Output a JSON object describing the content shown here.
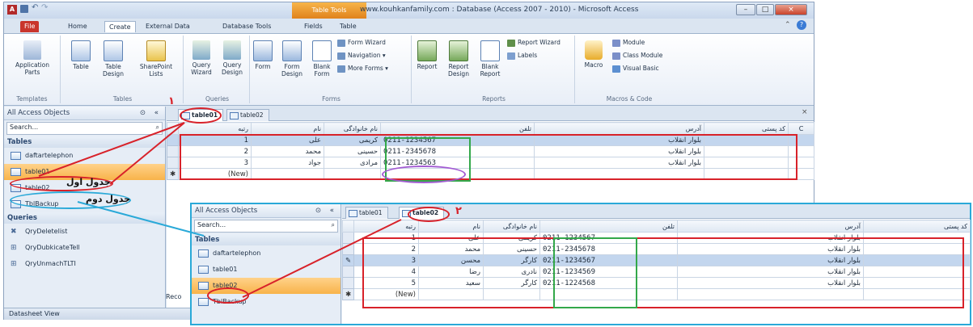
{
  "window": {
    "title": "www.kouhkanfamily.com : Database (Access 2007 - 2010) - Microsoft Access",
    "context_tab": "Table Tools",
    "controls": [
      "–",
      "□",
      "×"
    ]
  },
  "ribbon_tabs": [
    "File",
    "Home",
    "Create",
    "External Data",
    "Database Tools",
    "Fields",
    "Table"
  ],
  "ribbon": {
    "templates": {
      "label": "Templates",
      "buttons": [
        "Application Parts"
      ]
    },
    "tables": {
      "label": "Tables",
      "buttons": [
        "Table",
        "Table Design",
        "SharePoint Lists"
      ]
    },
    "queries": {
      "label": "Queries",
      "buttons": [
        "Query Wizard",
        "Query Design"
      ]
    },
    "forms": {
      "label": "Forms",
      "buttons": [
        "Form",
        "Form Design",
        "Blank Form"
      ],
      "small": [
        "Form Wizard",
        "Navigation",
        "More Forms"
      ]
    },
    "reports": {
      "label": "Reports",
      "buttons": [
        "Report",
        "Report Design",
        "Blank Report"
      ],
      "small": [
        "Report Wizard",
        "Labels"
      ]
    },
    "macros": {
      "label": "Macros & Code",
      "buttons": [
        "Macro"
      ],
      "small": [
        "Module",
        "Class Module",
        "Visual Basic"
      ]
    }
  },
  "nav": {
    "title": "All Access Objects",
    "search_placeholder": "Search...",
    "tables_header": "Tables",
    "tables": [
      "daftartelephon",
      "table01",
      "table02",
      "TblBackup"
    ],
    "queries_header": "Queries",
    "queries": [
      "QryDeletelist",
      "QryDubkicateTell",
      "QryUnmachTLTI"
    ]
  },
  "status": {
    "text": "Datasheet View"
  },
  "doc1": {
    "tabs": [
      "table01",
      "table02"
    ],
    "columns": [
      "رتبه",
      "نام",
      "نام خانوادگی",
      "تلفن",
      "آدرس",
      "کد پستی"
    ],
    "rows": [
      {
        "id": "1",
        "name": "علی",
        "family": "کریمی",
        "phone": "0211-1234567",
        "address": "بلوار انقلاب"
      },
      {
        "id": "2",
        "name": "محمد",
        "family": "حسینی",
        "phone": "0211-2345678",
        "address": "بلوار انقلاب"
      },
      {
        "id": "3",
        "name": "جواد",
        "family": "مرادی",
        "phone": "0211-1234563",
        "address": "بلوار انقلاب"
      }
    ],
    "new_label": "(New)"
  },
  "doc2": {
    "tabs": [
      "table01",
      "table02"
    ],
    "columns": [
      "رتبه",
      "نام",
      "نام خانوادگی",
      "تلفن",
      "آدرس",
      "کد پستی"
    ],
    "rows": [
      {
        "id": "1",
        "name": "علی",
        "family": "کریمی",
        "phone": "0211-1234567",
        "address": "بلوار انقلاب"
      },
      {
        "id": "2",
        "name": "محمد",
        "family": "حسینی",
        "phone": "0211-2345678",
        "address": "بلوار انقلاب"
      },
      {
        "id": "3",
        "name": "محسن",
        "family": "کارگر",
        "phone": "0211-1234567",
        "address": "بلوار انقلاب"
      },
      {
        "id": "4",
        "name": "رضا",
        "family": "نادری",
        "phone": "0211-1234569",
        "address": "بلوار انقلاب"
      },
      {
        "id": "5",
        "name": "سعید",
        "family": "کارگر",
        "phone": "0211-1224568",
        "address": "بلوار انقلاب"
      }
    ],
    "new_label": "(New)",
    "records_label": "Reco"
  },
  "annotations": {
    "num1": "۱",
    "num2": "۲",
    "label1": "جدول اول",
    "label2": "جدول دوم"
  },
  "colors": {
    "red": "#d8222a",
    "green": "#33a84a",
    "purple": "#a35bd3",
    "blue": "#2aa9d8",
    "orange": "#f8b34a"
  }
}
